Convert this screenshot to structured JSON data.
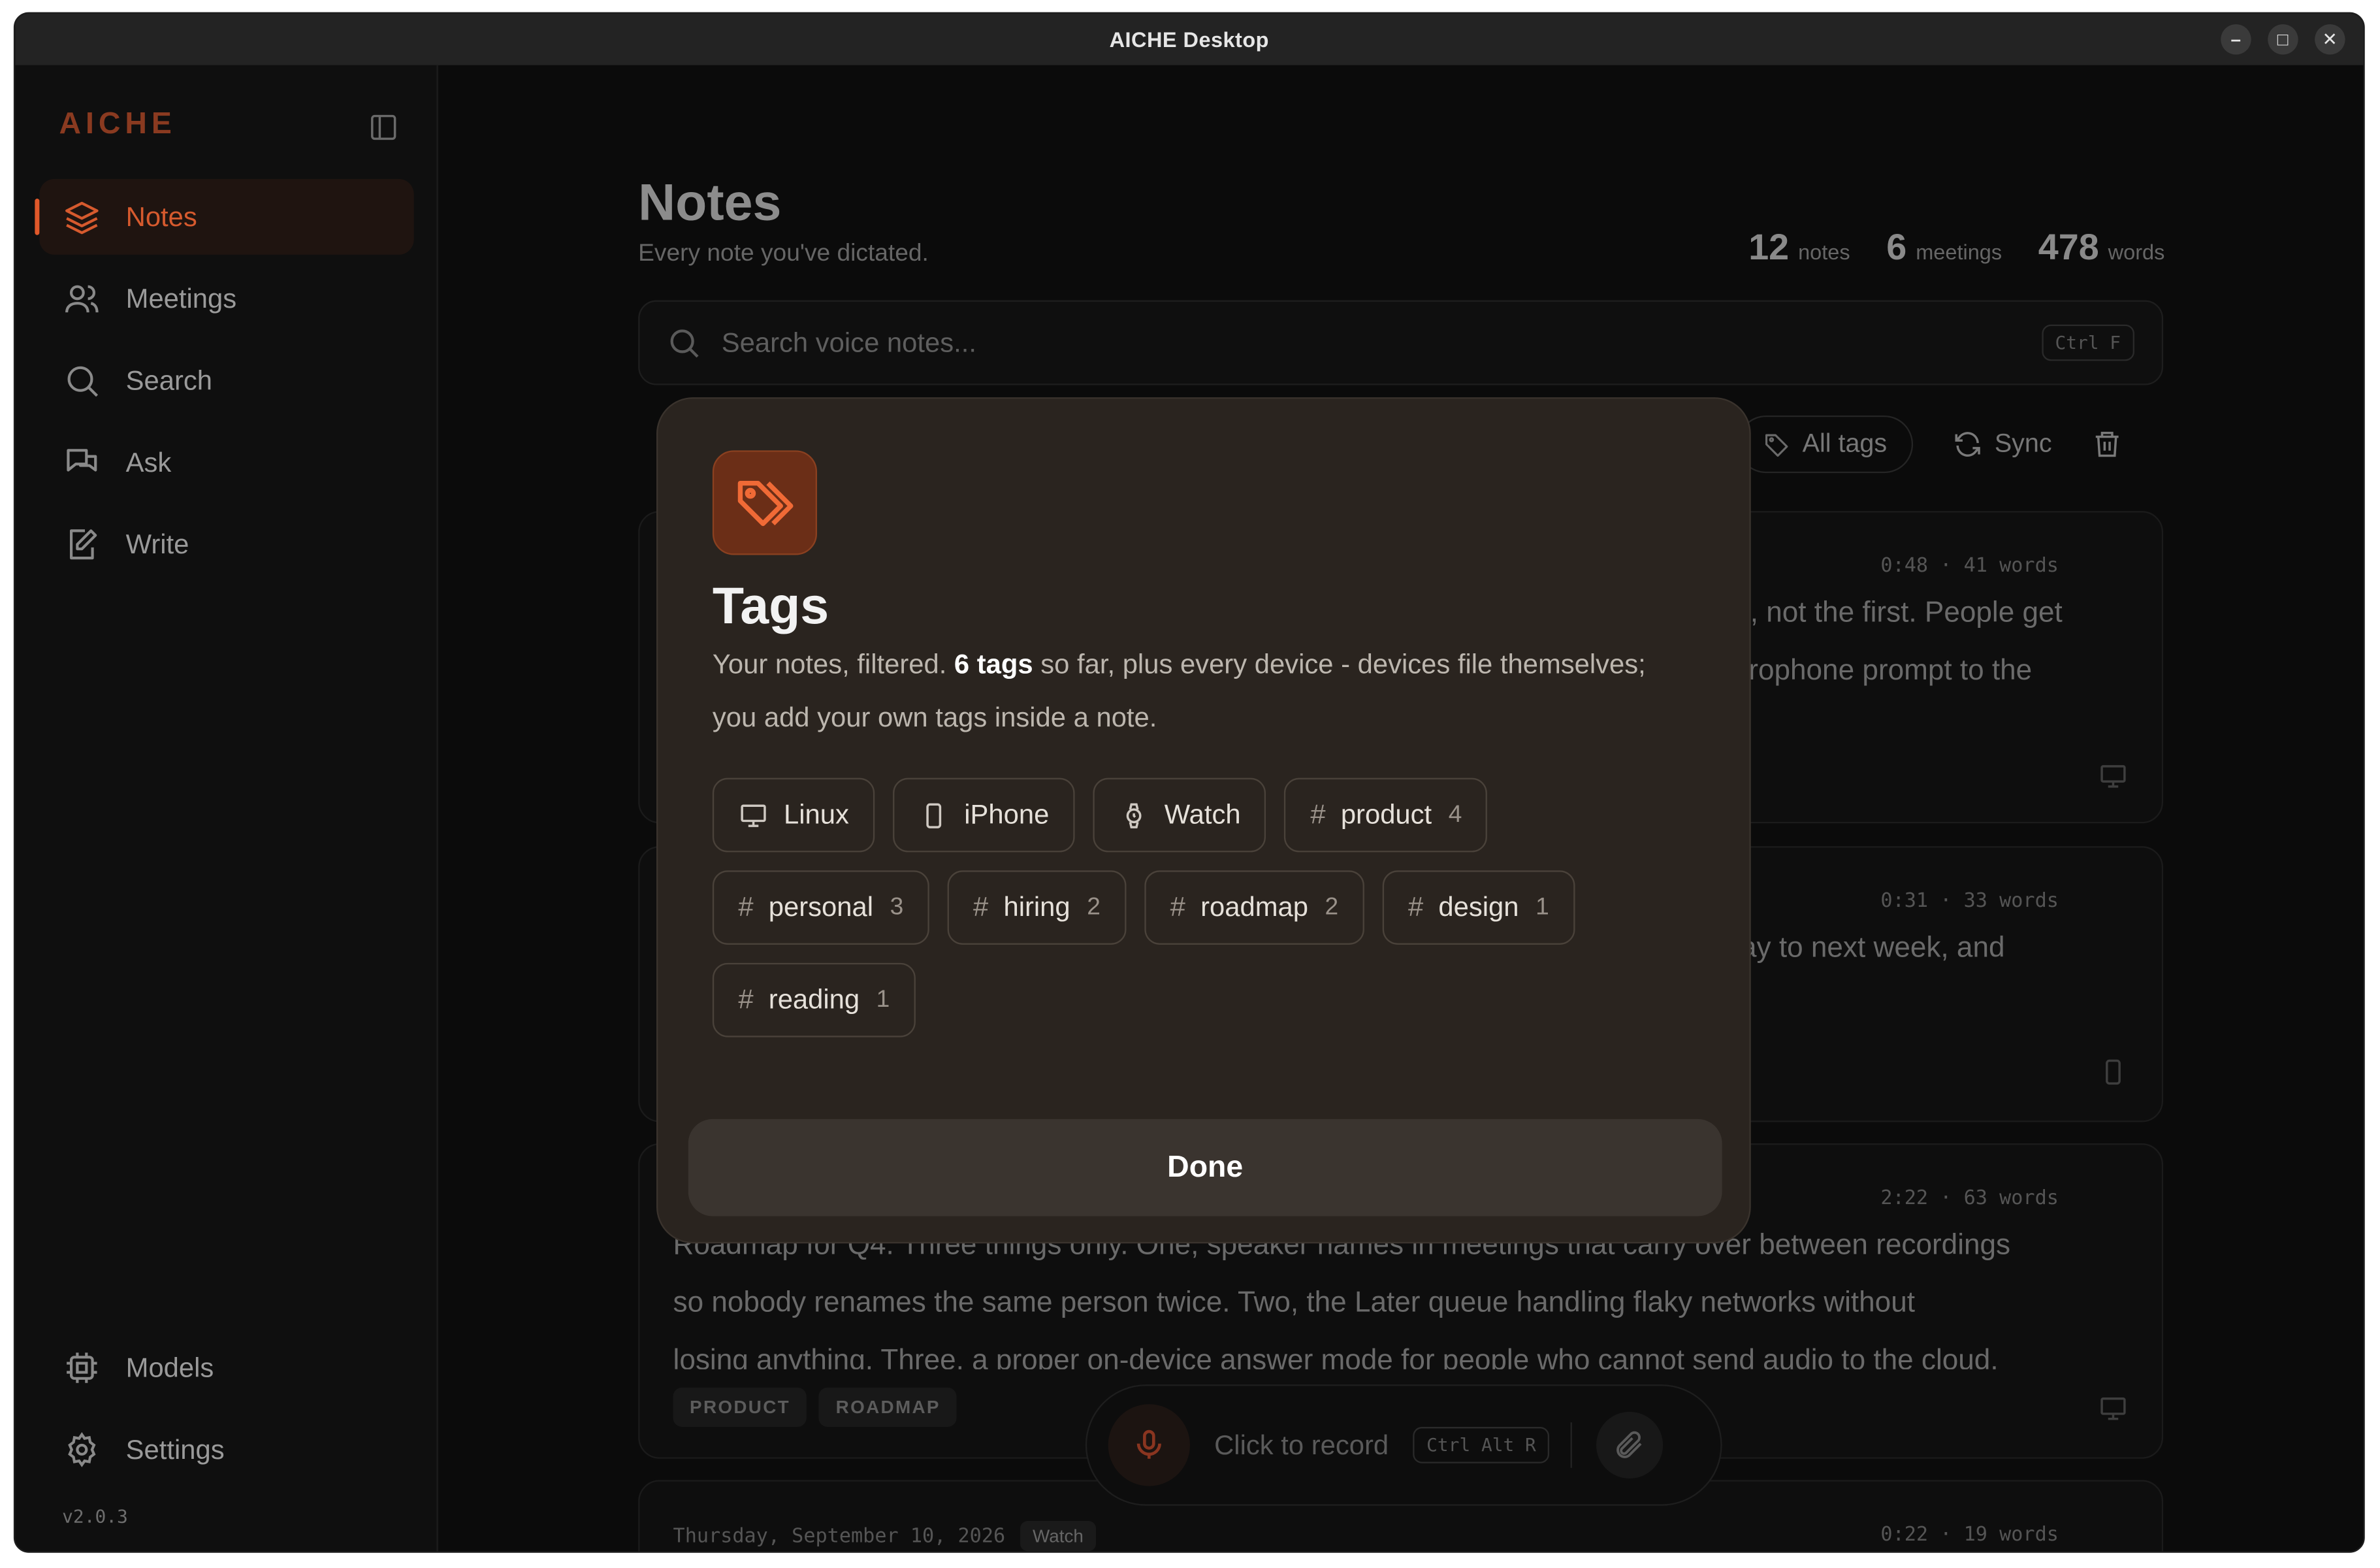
{
  "window": {
    "title": "AICHE Desktop",
    "minimize": "–",
    "maximize": "□",
    "close": "✕"
  },
  "sidebar": {
    "logo": "AICHE",
    "items": [
      {
        "label": "Notes",
        "icon": "layers-icon",
        "active": true
      },
      {
        "label": "Meetings",
        "icon": "users-icon"
      },
      {
        "label": "Search",
        "icon": "search-icon"
      },
      {
        "label": "Ask",
        "icon": "chat-icon"
      },
      {
        "label": "Write",
        "icon": "pen-icon"
      }
    ],
    "bottom": [
      {
        "label": "Models",
        "icon": "cpu-icon"
      },
      {
        "label": "Settings",
        "icon": "gear-icon"
      }
    ],
    "version": "v2.0.3"
  },
  "main": {
    "title": "Notes",
    "subtitle": "Every note you've dictated.",
    "stats": [
      {
        "n": "12",
        "label": "notes"
      },
      {
        "n": "6",
        "label": "meetings"
      },
      {
        "n": "478",
        "label": "words"
      }
    ],
    "search": {
      "placeholder": "Search voice notes...",
      "shortcut": "Ctrl F"
    },
    "toolbar": {
      "all_tags": "All tags",
      "sync": "Sync"
    },
    "cards": [
      {
        "meta": "0:48 · 41 words",
        "line1": "n, not the first. People get",
        "line2": "crophone prompt to the"
      },
      {
        "meta": "0:31 · 33 words",
        "line1": "lay to next week, and"
      },
      {
        "meta": "2:22 · 63 words",
        "line1": "Roadmap for Q4. Three things only. One, speaker names in meetings that carry over between recordings",
        "line2": "so nobody renames the same person twice. Two, the Later queue handling flaky networks without",
        "line3": "losing anything. Three, a proper on-device answer mode for people who cannot send audio to the cloud.",
        "tags": [
          "PRODUCT",
          "ROADMAP"
        ]
      },
      {
        "meta": "0:22 · 19 words",
        "date": "Thursday, September 10, 2026",
        "tag": "Watch"
      }
    ],
    "recorder": {
      "label": "Click to record",
      "shortcut": "Ctrl Alt R"
    }
  },
  "modal": {
    "title": "Tags",
    "desc_pre": "Your notes, filtered. ",
    "desc_bold": "6 tags",
    "desc_post": " so far, plus every device - devices file themselves; you add your own tags inside a note.",
    "devices": [
      {
        "label": "Linux",
        "icon": "monitor-icon"
      },
      {
        "label": "iPhone",
        "icon": "phone-icon"
      },
      {
        "label": "Watch",
        "icon": "watch-icon"
      }
    ],
    "tags": [
      {
        "label": "product",
        "count": "4"
      },
      {
        "label": "personal",
        "count": "3"
      },
      {
        "label": "hiring",
        "count": "2"
      },
      {
        "label": "roadmap",
        "count": "2"
      },
      {
        "label": "design",
        "count": "1"
      },
      {
        "label": "reading",
        "count": "1"
      }
    ],
    "done_label": "Done",
    "accent": "#e0582a"
  }
}
